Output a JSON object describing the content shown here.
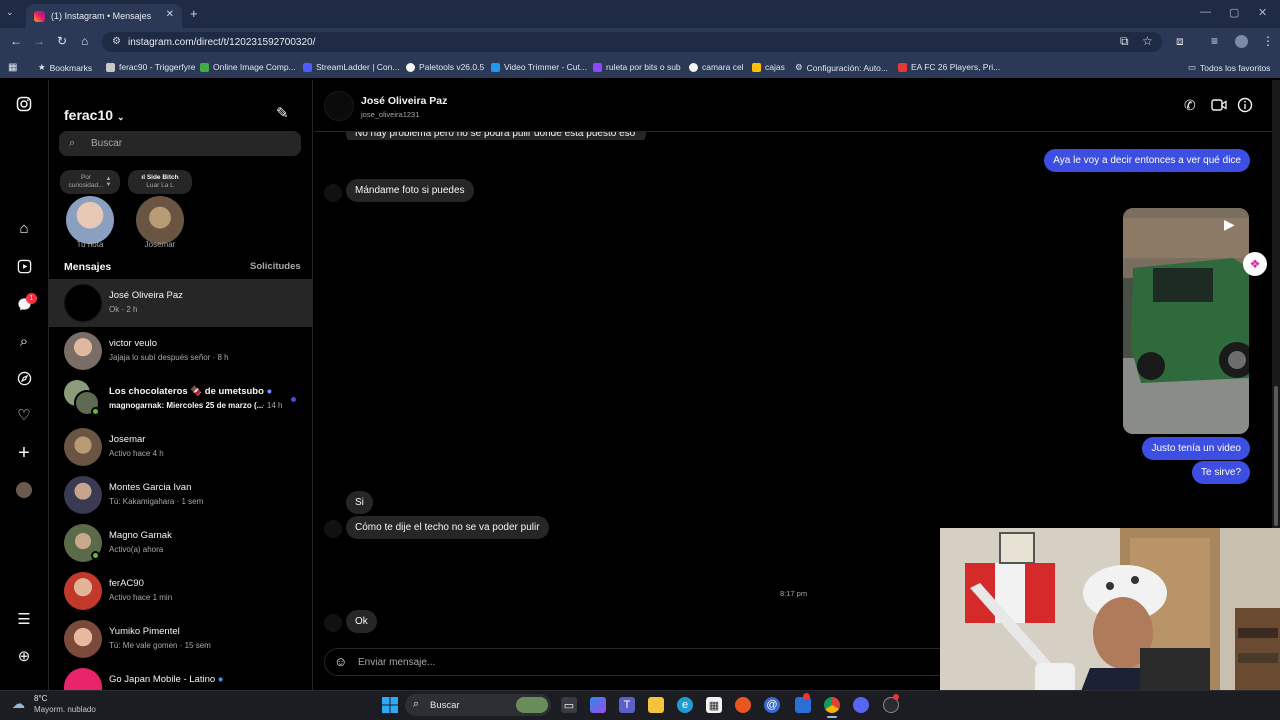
{
  "browser": {
    "tab_title": "(1) Instagram • Mensajes",
    "tab_close": "✕",
    "new_tab": "+",
    "url": "instagram.com/direct/t/120231592700320/",
    "bookmarks": [
      {
        "label": "Bookmarks",
        "color": "#f5f5f5"
      },
      {
        "label": "ferac90 - Triggerfyre",
        "color": "#c8c8c8"
      },
      {
        "label": "Online Image Comp...",
        "color": "#3fae49"
      },
      {
        "label": "StreamLadder | Con...",
        "color": "#4c5cff"
      },
      {
        "label": "Paletools v26.0.5",
        "color": "#f5f5f5"
      },
      {
        "label": "Video Trimmer - Cut...",
        "color": "#2196f3"
      },
      {
        "label": "ruleta por bits o sub",
        "color": "#9146ff"
      },
      {
        "label": "camara cel",
        "color": "#f5f5f5"
      },
      {
        "label": "cajas",
        "color": "#ffc107"
      },
      {
        "label": "Configuración: Auto...",
        "color": "#f5f5f5"
      },
      {
        "label": "EA FC 26 Players, Pri...",
        "color": "#e53935"
      }
    ],
    "all_favorites": "Todos los favoritos"
  },
  "sidebar": {
    "username": "ferac10",
    "search_placeholder": "Buscar",
    "notes": [
      {
        "note": "Por curiosidad...",
        "name": "Tu nota"
      },
      {
        "note": "Side Bitch · Luar La L",
        "name": "Josemar"
      }
    ],
    "note_line1_a": "Por",
    "note_line2_a": "curiosidad...",
    "note_line1_b": "Side Bitch",
    "note_line2_b": "Luar La L",
    "section_title": "Mensajes",
    "requests_label": "Solicitudes",
    "notification_count": "1",
    "conversations": [
      {
        "name": "José Oliveira Paz",
        "sub": "Ok · 2 h"
      },
      {
        "name": "victor veulo",
        "sub": "Jajaja lo subí después señor · 8 h"
      },
      {
        "name": "Los chocolateros 🍫 de umetsubo",
        "sub": "magnogarnak: Miercoles 25 de marzo (...",
        "time": "· 14 h"
      },
      {
        "name": "Josemar",
        "sub": "Activo hace 4 h"
      },
      {
        "name": "Montes Garcia Ivan",
        "sub": "Tú: Kakamigahara · 1 sem"
      },
      {
        "name": "Magno Garnak",
        "sub": "Activo(a) ahora"
      },
      {
        "name": "ferAC90",
        "sub": "Activo hace 1 min"
      },
      {
        "name": "Yumiko Pimentel",
        "sub": "Tú: Me vale gomen · 15 sem"
      },
      {
        "name": "Go Japan Mobile - Latino",
        "sub": ""
      }
    ]
  },
  "chat": {
    "contact_name": "José Oliveira Paz",
    "contact_handle": "jose_oliveira1231",
    "cut_message": "No hay problema pero no se podrá pulir donde está puesto eso",
    "messages": {
      "out_1": "Aya le voy a decir entonces a ver qué dice",
      "in_1": "Mándame foto si puedes",
      "out_2": "Justo tenía un video",
      "out_3": "Te sirve?",
      "in_2": "Si",
      "in_3": "Cómo te dije el techo no se va poder pulir",
      "timestamp": "8:17 pm",
      "in_4": "Ok"
    },
    "composer_placeholder": "Enviar mensaje..."
  },
  "taskbar": {
    "weather_temp": "8°C",
    "weather_desc": "Mayorm. nublado",
    "search_label": "Buscar"
  },
  "colors": {
    "outgoing_bubble": "#3d4fe3",
    "incoming_bubble": "#262626",
    "active_convo": "#262626",
    "browser_frame": "#2b3856"
  }
}
